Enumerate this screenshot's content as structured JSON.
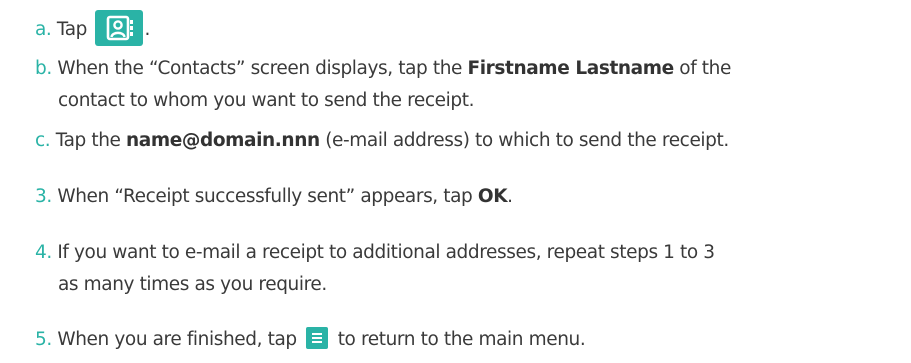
{
  "colors": {
    "accent": "#2ab3a6",
    "text": "#3a3a3a"
  },
  "steps": {
    "a": {
      "num": "a.",
      "text_before": "Tap",
      "icon": "contacts-icon",
      "text_after": "."
    },
    "b": {
      "num": "b.",
      "text1": "When the “Contacts” screen displays, tap the",
      "bold": "Firstname Lastname",
      "text2": "of the",
      "text3": "contact to whom you want to send the receipt."
    },
    "c": {
      "num": "c.",
      "text1": "Tap the",
      "bold": "name@domain.nnn",
      "text2": "(e-mail address) to which to send the receipt."
    },
    "s3": {
      "num": "3.",
      "text1": "When “Receipt successfully sent” appears, tap",
      "bold": "OK",
      "text2": "."
    },
    "s4": {
      "num": "4.",
      "text1": "If you want to e-mail a receipt to additional addresses, repeat steps 1 to 3",
      "text2": "as many times as you require."
    },
    "s5": {
      "num": "5.",
      "text1": "When you are finished, tap",
      "icon": "menu-icon",
      "text2": "to return to the main menu."
    }
  }
}
